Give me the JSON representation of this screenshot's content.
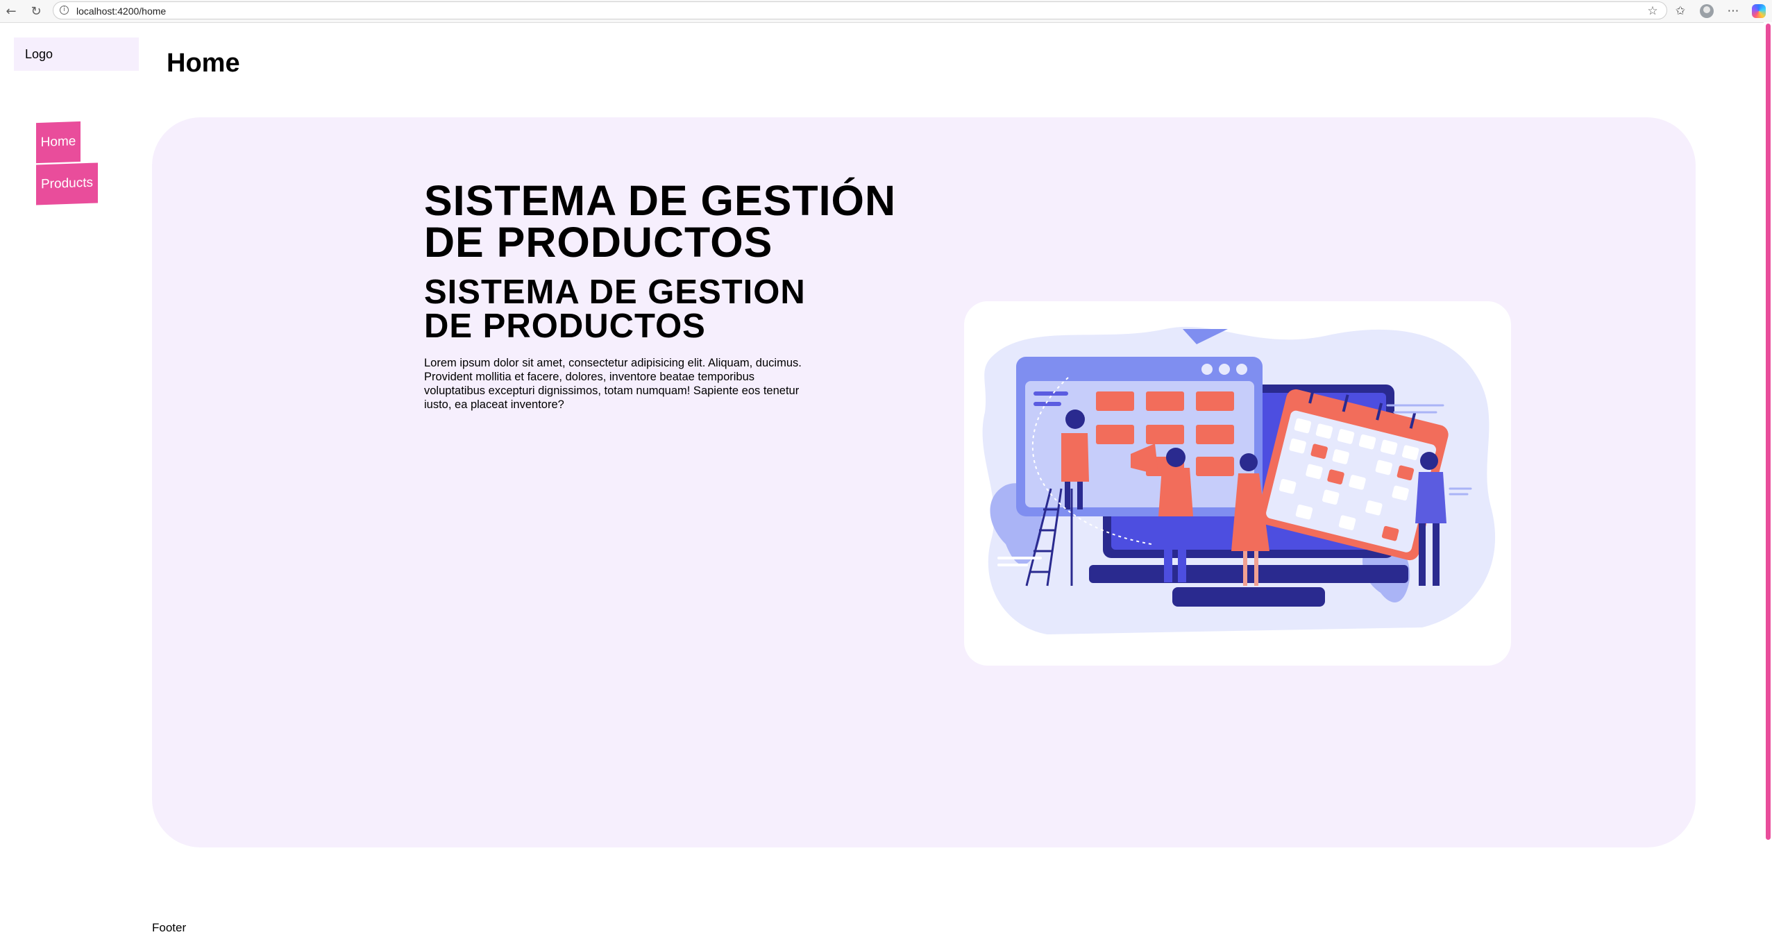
{
  "browser": {
    "url": "localhost:4200/home",
    "icons": [
      "back-icon",
      "reload-icon",
      "site-info-icon",
      "favorite-star-icon",
      "favorites-icon",
      "profile-icon",
      "more-icon",
      "copilot-icon"
    ]
  },
  "sidebar": {
    "logo": "Logo",
    "items": [
      {
        "label": "Home"
      },
      {
        "label": "Products"
      }
    ]
  },
  "header": {
    "title": "Home"
  },
  "hero": {
    "heading": "SISTEMA DE GESTIÓN DE PRODUCTOS",
    "subheading": "SISTEMA DE GESTION DE PRODUCTOS",
    "paragraph": "Lorem ipsum dolor sit amet, consectetur adipisicing elit. Aliquam, ducimus. Provident mollitia et facere, dolores, inventore beatae temporibus voluptatibus excepturi dignissimos, totam numquam! Sapiente eos tenetur iusto, ea placeat inventore?"
  },
  "footer": {
    "text": "Footer"
  },
  "colors": {
    "accent": "#e94d9b",
    "hero_background": "#f6effd",
    "illustration_primary": "#5b5ce0",
    "illustration_secondary": "#f26d5b"
  }
}
